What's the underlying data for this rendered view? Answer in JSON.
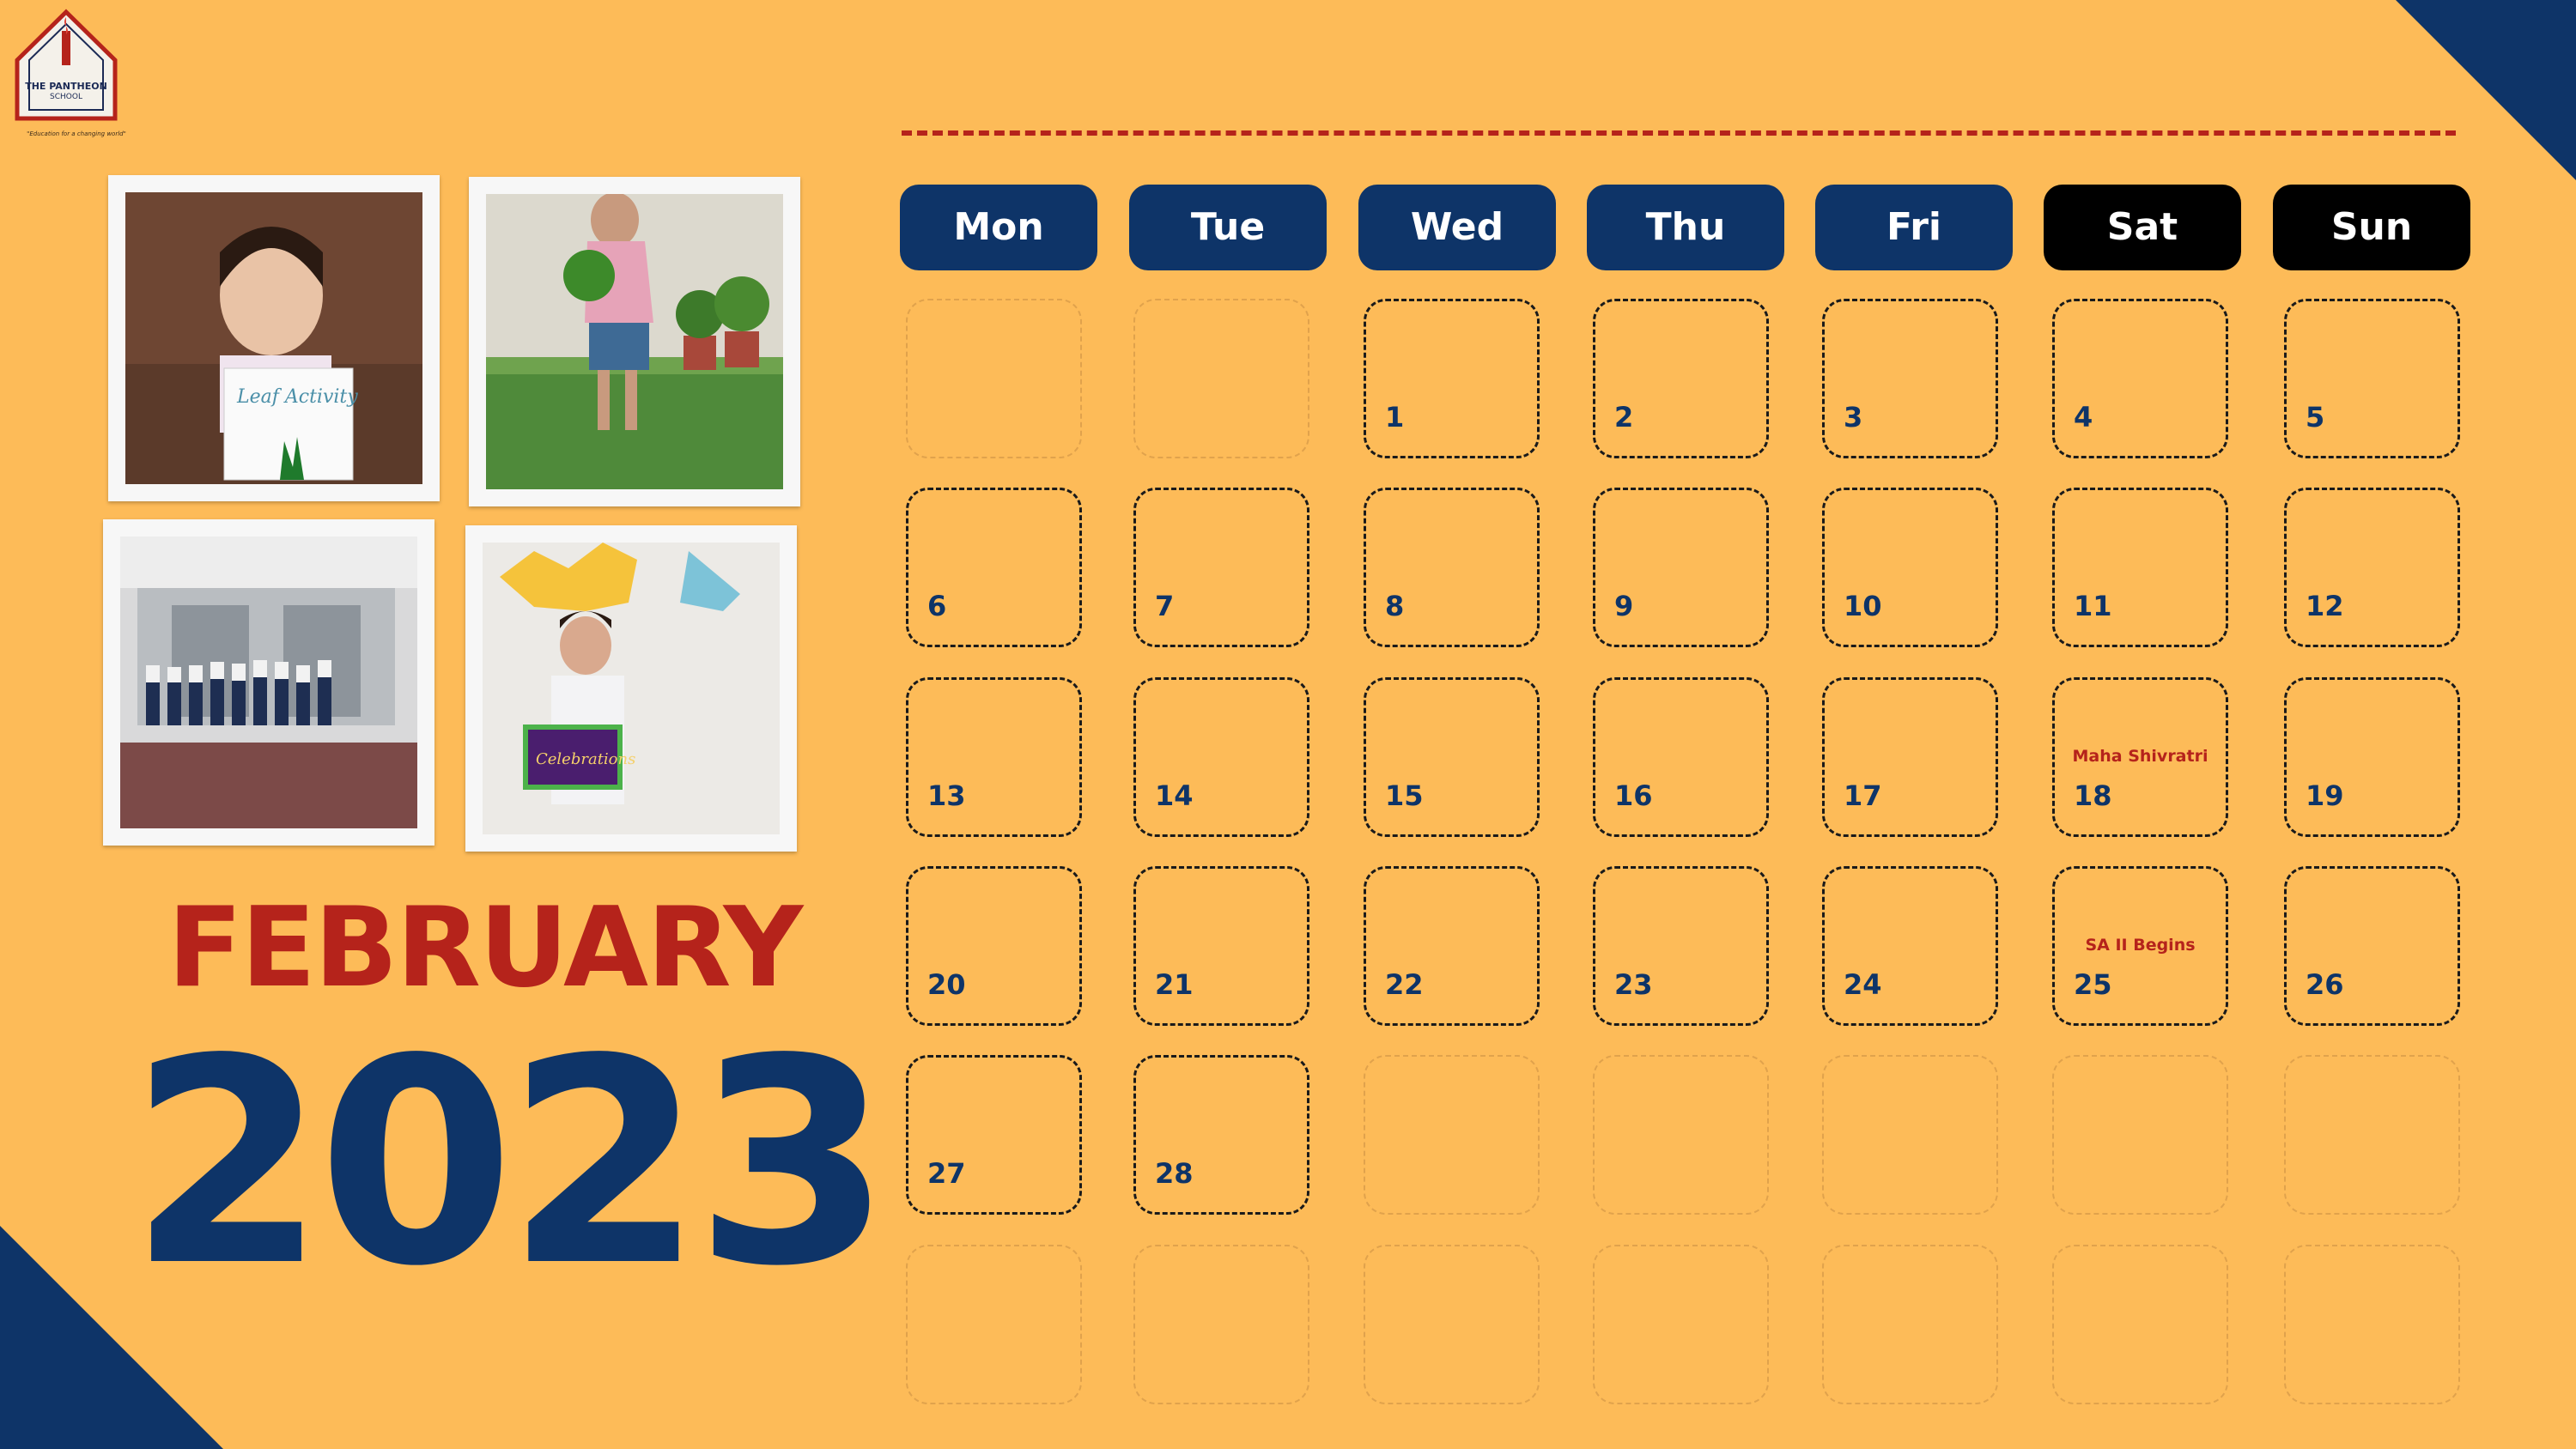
{
  "logo": {
    "name": "THE PANTHEON",
    "sub": "SCHOOL",
    "tagline": "\"Education for a changing world\""
  },
  "calendar": {
    "month": "FEBRUARY",
    "year": "2023",
    "weekdays": [
      "Mon",
      "Tue",
      "Wed",
      "Thu",
      "Fri",
      "Sat",
      "Sun"
    ],
    "weekend": [
      "Sat",
      "Sun"
    ],
    "rows": [
      [
        "",
        "",
        "1",
        "2",
        "3",
        "4",
        "5"
      ],
      [
        "6",
        "7",
        "8",
        "9",
        "10",
        "11",
        "12"
      ],
      [
        "13",
        "14",
        "15",
        "16",
        "17",
        "18",
        "19"
      ],
      [
        "20",
        "21",
        "22",
        "23",
        "24",
        "25",
        "26"
      ],
      [
        "27",
        "28",
        "",
        "",
        "",
        "",
        ""
      ],
      [
        "",
        "",
        "",
        "",
        "",
        "",
        ""
      ]
    ],
    "events": {
      "18": "Maha Shivratri",
      "25": "SA II Begins"
    }
  },
  "photos": [
    {
      "name": "photo-leaf-activity",
      "caption_in_image": "Leaf Activity"
    },
    {
      "name": "photo-child-with-plant"
    },
    {
      "name": "photo-students-at-entrance"
    },
    {
      "name": "photo-child-with-chocolate-box",
      "caption_in_image": "Celebrations"
    }
  ],
  "colors": {
    "background": "#FDBB58",
    "navy": "#0E3468",
    "red": "#B5231B",
    "weekend_header": "#000000"
  }
}
